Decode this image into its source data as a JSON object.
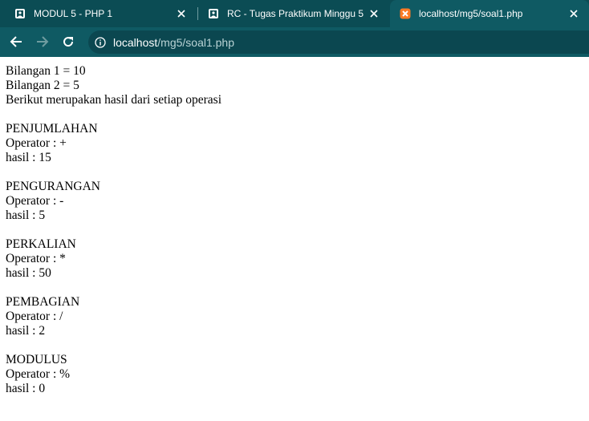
{
  "browser": {
    "tabs": [
      {
        "title": "MODUL 5 - PHP 1",
        "active": false,
        "icon": "page-icon"
      },
      {
        "title": "RC - Tugas Praktikum Minggu 5",
        "active": false,
        "icon": "page-icon"
      },
      {
        "title": "localhost/mg5/soal1.php",
        "active": true,
        "icon": "xampp-icon"
      }
    ],
    "address": {
      "host": "localhost",
      "path": "/mg5/soal1.php"
    },
    "colors": {
      "frame": "#0b4c54",
      "toolbar": "#0f5a63",
      "omnibox": "#0b4750"
    }
  },
  "page": {
    "intro": [
      "Bilangan 1 = 10",
      "Bilangan 2 = 5",
      "Berikut merupakan hasil dari setiap operasi"
    ],
    "operations": [
      {
        "name": "PENJUMLAHAN",
        "operator": "Operator : +",
        "result": "hasil : 15"
      },
      {
        "name": "PENGURANGAN",
        "operator": "Operator : -",
        "result": "hasil : 5"
      },
      {
        "name": "PERKALIAN",
        "operator": "Operator : *",
        "result": "hasil : 50"
      },
      {
        "name": "PEMBAGIAN",
        "operator": "Operator : /",
        "result": "hasil : 2"
      },
      {
        "name": "MODULUS",
        "operator": "Operator : %",
        "result": "hasil : 0"
      }
    ]
  }
}
